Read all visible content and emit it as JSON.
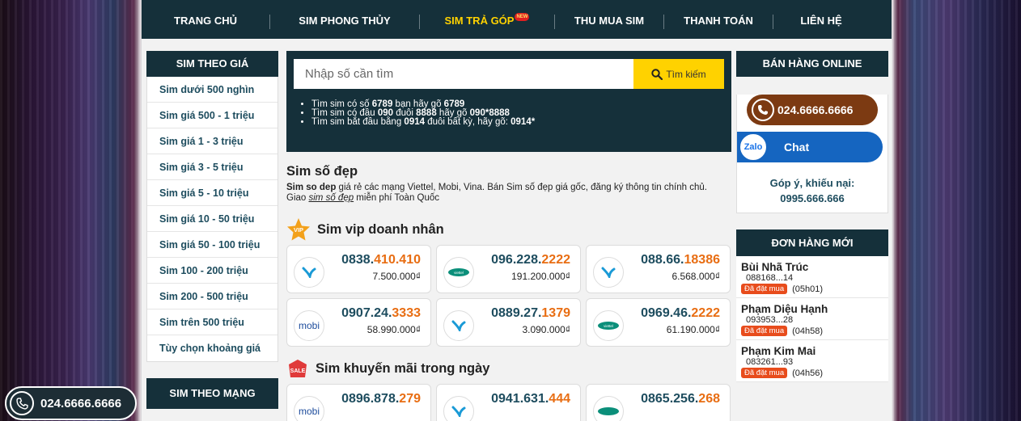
{
  "nav": {
    "items": [
      "TRANG CHỦ",
      "SIM PHONG THỦY",
      "SIM TRẢ GÓP",
      "THU MUA SIM",
      "THANH TOÁN",
      "LIÊN HỆ"
    ],
    "new_badge": "NEW",
    "active_color": "#ffd200"
  },
  "left": {
    "price_title": "SIM THEO GIÁ",
    "price_items": [
      "Sim dưới 500 nghìn",
      "Sim giá 500 - 1 triệu",
      "Sim giá 1 - 3 triệu",
      "Sim giá 3 - 5 triệu",
      "Sim giá 5 - 10 triệu",
      "Sim giá 10 - 50 triệu",
      "Sim giá 50 - 100 triệu",
      "Sim 100 - 200 triệu",
      "Sim 200 - 500 triệu",
      "Sim trên 500 triệu",
      "Tùy chọn khoảng giá"
    ],
    "network_title": "SIM THEO MẠNG"
  },
  "search": {
    "placeholder": "Nhập số cần tìm",
    "button": "Tìm kiếm",
    "tips": [
      {
        "a": "Tìm sim có số ",
        "b": "6789",
        "c": " bạn hãy gõ ",
        "d": "6789"
      },
      {
        "a": "Tìm sim có đầu ",
        "b": "090",
        "c": " đuôi ",
        "d": "8888",
        "e": " hãy gõ ",
        "f": "090*8888"
      },
      {
        "a": "Tìm sim bắt đầu bằng ",
        "b": "0914",
        "c": " đuôi bất kỳ, hãy gõ: ",
        "d": "0914*"
      }
    ]
  },
  "intro": {
    "title": "Sim số đẹp",
    "desc_bold": "Sim so dep",
    "desc_1": " giá rẻ các mạng Viettel, Mobi, Vina. Bán Sim số đẹp giá gốc, đăng ký thông tin chính chủ. Giao ",
    "desc_link": "sim số đẹp",
    "desc_2": " miễn phí Toàn Quốc"
  },
  "vip": {
    "title": "Sim vip doanh nhân",
    "badge": "VIP",
    "sims": [
      {
        "head": "0838.",
        "tail": "410.410",
        "price": "7.500.000₫",
        "carrier": "vinaphone"
      },
      {
        "head": "096.228.",
        "tail": "2222",
        "price": "191.200.000₫",
        "carrier": "viettel"
      },
      {
        "head": "088.66.",
        "tail": "18386",
        "price": "6.568.000₫",
        "carrier": "vinaphone"
      },
      {
        "head": "0907.24.",
        "tail": "3333",
        "price": "58.990.000₫",
        "carrier": "mobi"
      },
      {
        "head": "0889.27.",
        "tail": "1379",
        "price": "3.090.000₫",
        "carrier": "vinaphone"
      },
      {
        "head": "0969.46.",
        "tail": "2222",
        "price": "61.190.000₫",
        "carrier": "viettel"
      }
    ]
  },
  "sale": {
    "title": "Sim khuyến mãi trong ngày",
    "badge": "SALE",
    "sims": [
      {
        "head": "0896.878.",
        "tail": "279",
        "carrier": "mobi"
      },
      {
        "head": "0941.631.",
        "tail": "444",
        "carrier": "vinaphone"
      },
      {
        "head": "0865.256.",
        "tail": "268",
        "carrier": "viettel"
      }
    ]
  },
  "right": {
    "online_title": "BÁN HÀNG ONLINE",
    "phone": "024.6666.6666",
    "zalo_logo": "Zalo",
    "zalo_label": "Chat",
    "feedback_label": "Góp ý, khiếu nại:",
    "feedback_phone": "0995.666.666",
    "orders_title": "ĐƠN HÀNG MỚI",
    "orders": [
      {
        "name": "Bùi Nhã Trúc",
        "phone": "088168...14",
        "status": "Đã đặt mua",
        "time": "(05h01)"
      },
      {
        "name": "Phạm Diệu Hạnh",
        "phone": "093953...28",
        "status": "Đã đặt mua",
        "time": "(04h58)"
      },
      {
        "name": "Phạm Kim Mai",
        "phone": "083261...93",
        "status": "Đã đặt mua",
        "time": "(04h56)"
      }
    ]
  },
  "float_call": {
    "phone": "024.6666.6666"
  },
  "colors": {
    "nav_bg": "#15303a",
    "accent": "#ffd200",
    "number": "#1d4c5e",
    "tail": "#e86d12",
    "phone_btn": "#7c3a12",
    "zalo_btn": "#1565c0"
  }
}
